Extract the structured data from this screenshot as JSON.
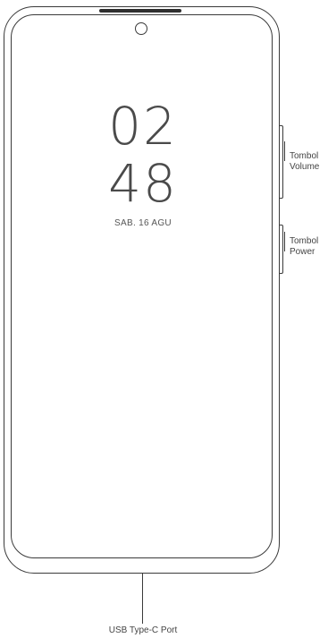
{
  "clock": {
    "hours": "02",
    "minutes": "48",
    "date": "SAB. 16 AGU"
  },
  "labels": {
    "volume_line1": "Tombol",
    "volume_line2": "Volume",
    "power_line1": "Tombol",
    "power_line2": "Power",
    "usb": "USB Type-C Port"
  }
}
